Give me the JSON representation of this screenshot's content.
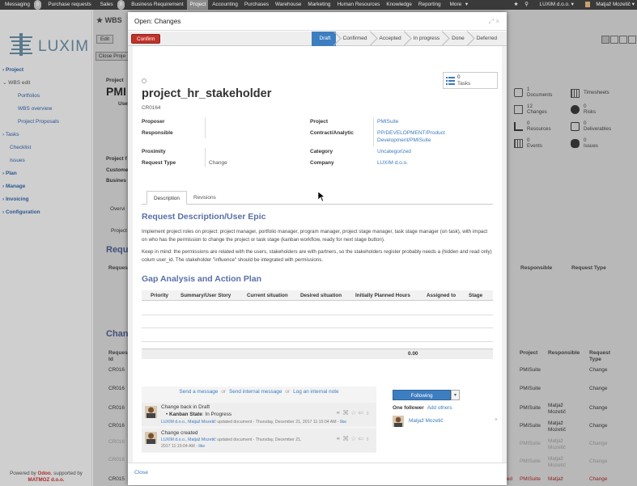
{
  "topbar": {
    "menu": [
      "Messaging",
      "Purchase requests",
      "Sales",
      "Business Requirement",
      "Project",
      "Accounting",
      "Purchases",
      "Warehouse",
      "Marketing",
      "Human Resources",
      "Knowledge",
      "Reporting",
      "More"
    ],
    "messaging_badge": "8",
    "sales_badge": "8",
    "active": "Project",
    "company": "LUXIM d.o.o.",
    "user": "Matjaž Mozetič"
  },
  "sidebar": {
    "logo_text": "LUXIM",
    "items": [
      {
        "label": "Project",
        "level": 1
      },
      {
        "label": "WBS edit",
        "level": 1
      },
      {
        "label": "Portfolios",
        "level": 2
      },
      {
        "label": "WBS overview",
        "level": 2
      },
      {
        "label": "Project Proposals",
        "level": 2
      },
      {
        "label": "Tasks",
        "level": 1
      },
      {
        "label": "Checklist",
        "level": 2
      },
      {
        "label": "Issues",
        "level": 2
      },
      {
        "label": "Plan",
        "level": 1
      },
      {
        "label": "Manage",
        "level": 1
      },
      {
        "label": "Invoicing",
        "level": 1
      },
      {
        "label": "Configuration",
        "level": 1
      }
    ],
    "powered_prefix": "Powered by",
    "powered_brand": "Odoo",
    "powered_suffix": ", supported by",
    "powered_company": "MATMOZ d.o.o."
  },
  "background": {
    "breadcrumb": "WBS",
    "edit": "Edit",
    "close_project": "Close Proje",
    "project_label": "Project",
    "project_name": "PMI",
    "use_label": "Use",
    "field1": "Project f",
    "field2": "Custome",
    "field3": "Busines",
    "overview_tab": "Overvi",
    "project_tab": "Project",
    "req_title": "Requ",
    "req_col": "Reques",
    "change_title": "Chan",
    "change_col1": "Reques",
    "change_col1b": "Id",
    "right_stats": [
      {
        "n": "1",
        "l": "Documents"
      },
      {
        "n": "",
        "l": "Timesheets"
      },
      {
        "n": "12",
        "l": "Changes"
      },
      {
        "n": "0",
        "l": "Risks"
      },
      {
        "n": "0",
        "l": "Resources"
      },
      {
        "n": "0",
        "l": "Deliverables"
      },
      {
        "n": "0",
        "l": "Events"
      },
      {
        "n": "0",
        "l": "Issues"
      }
    ],
    "req_headers": {
      "responsible": "Responsible",
      "type": "Request Type"
    },
    "change_headers": {
      "project": "Project",
      "responsible": "Responsible",
      "type": "Request",
      "type2": "Type"
    },
    "change_rows": [
      {
        "id": "CR016",
        "project": "PMISuite",
        "responsible": "",
        "responsible2": "",
        "type": "Change"
      },
      {
        "id": "CR016",
        "project": "PMISuite",
        "responsible": "",
        "responsible2": "",
        "type": "Change"
      },
      {
        "id": "CR016",
        "project": "PMISuite",
        "responsible": "Matjaž",
        "responsible2": "Mozetič",
        "type": "Change"
      },
      {
        "id": "CR016",
        "project": "PMISuite",
        "responsible": "Matjaž",
        "responsible2": "Mozetič",
        "type": "Change"
      },
      {
        "id": "CR016",
        "project": "PMISuite",
        "responsible": "Matjaž",
        "responsible2": "Mozetič",
        "type": "Change"
      },
      {
        "id": "CR016",
        "project": "PMISuite",
        "responsible": "Matjaž",
        "responsible2": "Mozetič",
        "type": "Change"
      },
      {
        "id": "CR015",
        "project": "PMISuite",
        "responsible": "Matjaž",
        "responsible2": "",
        "type": "Change"
      }
    ],
    "last_prefix": "ed"
  },
  "modal": {
    "title": "Open: Changes",
    "confirm_label": "Confirm",
    "stages": [
      "Draft",
      "Confirmed",
      "Accepted",
      "In progress",
      "Done",
      "Deferred"
    ],
    "current_stage": "Draft",
    "tasks_count": "0",
    "tasks_label": "Tasks",
    "record_name": "project_hr_stakeholder",
    "record_code": "CR0164",
    "fields_left": [
      {
        "label": "Proposer",
        "value": ""
      },
      {
        "label": "Responsible",
        "value": ""
      },
      {
        "label": "Proximity",
        "value": ""
      },
      {
        "label": "Request Type",
        "value": "Change"
      }
    ],
    "fields_right": [
      {
        "label": "Project",
        "value": "PMISuite"
      },
      {
        "label": "Contract/Analytic",
        "value": "PP/DEVELOPMENT/Product",
        "value2": "Development/PMISuite"
      },
      {
        "label": "Category",
        "value": "Uncategorized"
      },
      {
        "label": "Company",
        "value": "LUXIM d.o.o."
      }
    ],
    "tabs": [
      "Description",
      "Revisions"
    ],
    "section1_title": "Request Description/User Epic",
    "para1": "Implement project roles on project: project manager, portfolio manager, program manager, project stage manager, task stage manager (on task), with impact on who has the permission to change the project or task stage (kanban workflow, ready for next stage button).",
    "para2": "Keep in mind: the permissions are related with the users, stakeholders are with partners, so the stakeholders register probably needs a (hidden and read only) colum user_id. The stakeholder \"influence\" should be integrated with permissions.",
    "section2_title": "Gap Analysis and Action Plan",
    "gap_columns": [
      "Priority",
      "Summary/User Story",
      "Current situation",
      "Desired situation",
      "Initially Planned Hours",
      "Assigned to",
      "Stage"
    ],
    "gap_total": "0.00",
    "chatter": {
      "send_message": "Send a message",
      "or1": "or",
      "send_internal": "Send internal message",
      "or2": "or",
      "log_note": "Log an internal note",
      "messages": [
        {
          "title": "Change back in Draft",
          "detail_label": "Kanban State",
          "detail_value": "In Progress",
          "company": "LUXIM d.o.o.",
          "user": "Matjaž Mozetič",
          "action": "updated document - Thursday, December 21, 2017 11:15:04 AM -",
          "like": "like"
        },
        {
          "title": "Change created",
          "company": "LUXIM d.o.o.",
          "user": "Matjaž Mozetič",
          "action": "updated document - Thursday, December 21,",
          "action2": "2017 11:15:04 AM -",
          "like": "like"
        }
      ],
      "following_label": "Following",
      "followers_count_label": "One follower",
      "add_others": "Add others",
      "follower_name": "Matjaž Mozetič"
    },
    "close_label": "Close"
  },
  "colors": {
    "accent": "#3d7ec0",
    "confirm": "#c0332b",
    "section_title": "#5a6fa8",
    "topbar": "#3a3a3a"
  }
}
